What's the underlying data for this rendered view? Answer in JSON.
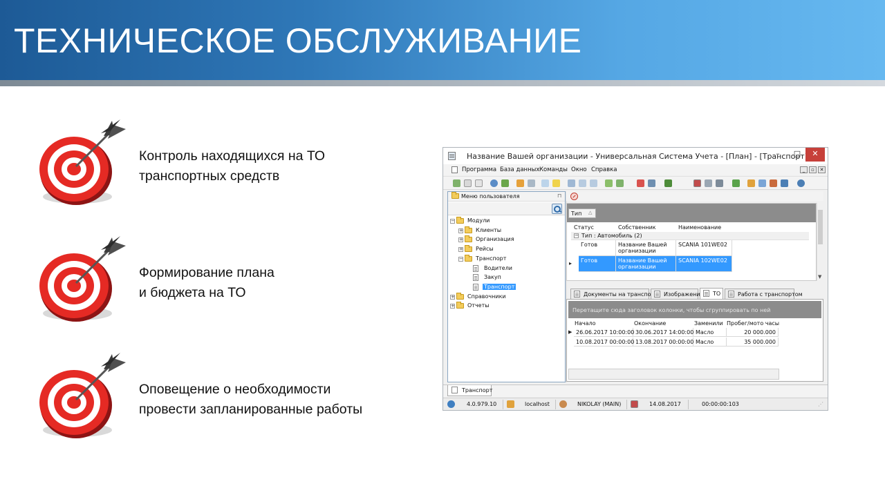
{
  "slide": {
    "title": "ТЕХНИЧЕСКОЕ ОБСЛУЖИВАНИЕ",
    "bullets": [
      {
        "icon": "target-dart-icon",
        "lines": [
          "Контроль находящихся на ТО",
          "транспортных средств"
        ]
      },
      {
        "icon": "target-dart-icon",
        "lines": [
          "Формирование плана",
          "и бюджета на ТО"
        ]
      },
      {
        "icon": "target-dart-icon",
        "lines": [
          "Оповещение о необходимости",
          "провести запланированные работы"
        ]
      }
    ]
  },
  "app": {
    "window_title": "Название Вашей организации - Универсальная Система Учета - [План] - [Транспорт]",
    "window_buttons": {
      "minimize": "–",
      "maximize": "□",
      "close": "✕"
    },
    "menu": [
      "Программа",
      "База данных",
      "Команды",
      "Окно",
      "Справка"
    ],
    "mdi_buttons": [
      "_",
      "▫",
      "✕"
    ],
    "left_panel": {
      "title": "Меню пользователя",
      "pin": "⊓",
      "tree": [
        {
          "label": "Модули",
          "level": 0,
          "expander": "−",
          "kind": "folder"
        },
        {
          "label": "Клиенты",
          "level": 1,
          "expander": "+",
          "kind": "folder"
        },
        {
          "label": "Организация",
          "level": 1,
          "expander": "+",
          "kind": "folder"
        },
        {
          "label": "Рейсы",
          "level": 1,
          "expander": "+",
          "kind": "folder"
        },
        {
          "label": "Транспорт",
          "level": 1,
          "expander": "−",
          "kind": "folder"
        },
        {
          "label": "Водители",
          "level": 2,
          "expander": "",
          "kind": "doc"
        },
        {
          "label": "Закуп",
          "level": 2,
          "expander": "",
          "kind": "doc"
        },
        {
          "label": "Транспорт",
          "level": 2,
          "expander": "",
          "kind": "doc",
          "selected": true
        },
        {
          "label": "Справочники",
          "level": 0,
          "expander": "+",
          "kind": "folder"
        },
        {
          "label": "Отчеты",
          "level": 0,
          "expander": "+",
          "kind": "folder"
        }
      ]
    },
    "grid1": {
      "group_chip": "Тип",
      "group_chip_arrow": "△",
      "columns": [
        "Статус",
        "Собственник",
        "Наименование"
      ],
      "group_row": {
        "expander": "−",
        "label": "Тип : Автомобиль (2)"
      },
      "rows": [
        {
          "status": "Готов",
          "owner": "Название Вашей организации",
          "name": "SCANIA 101WE02",
          "selected": false,
          "indicator": ""
        },
        {
          "status": "Готов",
          "owner": "Название Вашей организации",
          "name": "SCANIA 102WE02",
          "selected": true,
          "indicator": "▸"
        }
      ]
    },
    "tabs": [
      {
        "label": "Документы на транспорт",
        "active": false
      },
      {
        "label": "Изображение",
        "active": false
      },
      {
        "label": "ТО",
        "active": true
      },
      {
        "label": "Работа с транспортом",
        "active": false
      }
    ],
    "grid2": {
      "group_hint": "Перетащите сюда заголовок колонки, чтобы сгруппировать по ней",
      "columns": [
        "Начало",
        "Окончание",
        "Заменили",
        "Пробег/мото часы"
      ],
      "rows": [
        {
          "start": "26.06.2017 10:00:00",
          "end": "30.06.2017 14:00:00",
          "replaced": "Масло",
          "mileage": "20 000.000",
          "indicator": "▶"
        },
        {
          "start": "10.08.2017 00:00:00",
          "end": "13.08.2017 00:00:00",
          "replaced": "Масло",
          "mileage": "35 000.000",
          "indicator": ""
        }
      ]
    },
    "doc_tab": "Транспорт",
    "status": {
      "version": "4.0.979.10",
      "server": "localhost",
      "user": "NIKOLAY (MAIN)",
      "date": "14.08.2017",
      "timer": "00:00:00:103"
    },
    "colors": {
      "accent": "#3399ff",
      "close": "#c7403a",
      "banner": "#2f78b8"
    }
  }
}
